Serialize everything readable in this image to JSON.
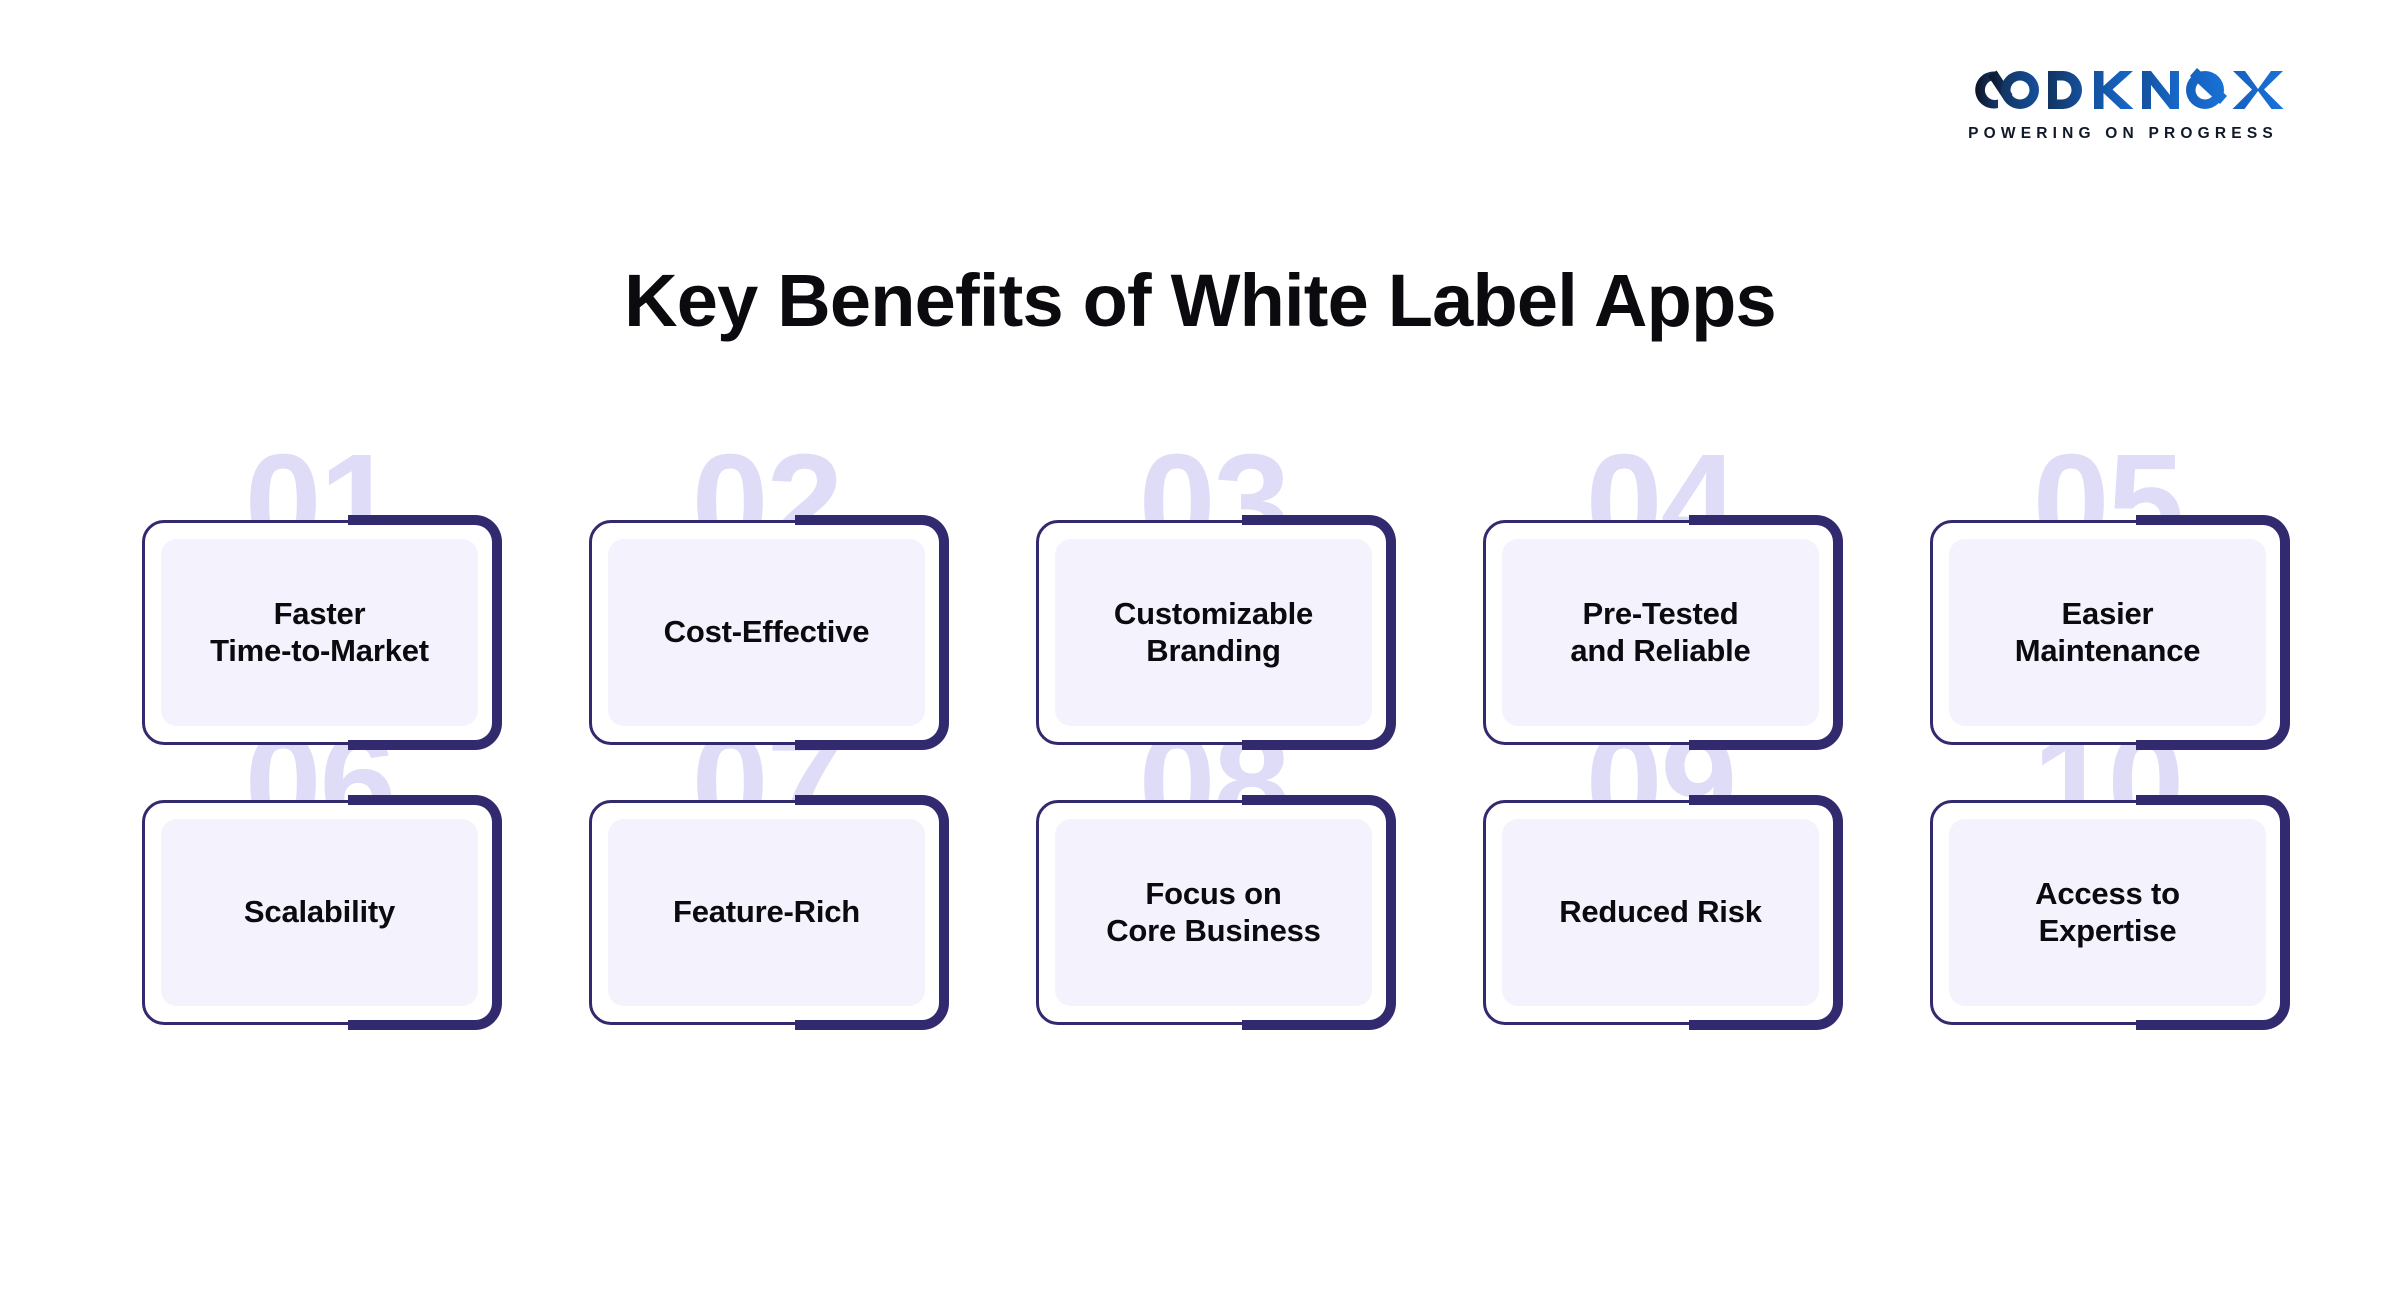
{
  "brand": {
    "logo_text": "CODKNOX",
    "logo_icon": "codknox-wordmark-logo",
    "tagline": "POWERING ON PROGRESS",
    "colors": {
      "logo_dark": "#0d1b33",
      "logo_blue": "#1565c0",
      "accent_navy": "#322a6e",
      "panel_lavender": "#f4f2fd",
      "ghost_number": "#dedcf7",
      "text_dark": "#0b0b0f",
      "background": "#ffffff"
    }
  },
  "header": {
    "title": "Key Benefits of White Label Apps"
  },
  "benefits": [
    {
      "number": "01",
      "label": "Faster\nTime-to-Market"
    },
    {
      "number": "02",
      "label": "Cost-Effective"
    },
    {
      "number": "03",
      "label": "Customizable\nBranding"
    },
    {
      "number": "04",
      "label": "Pre-Tested\nand Reliable"
    },
    {
      "number": "05",
      "label": "Easier\nMaintenance"
    },
    {
      "number": "06",
      "label": "Scalability"
    },
    {
      "number": "07",
      "label": "Feature-Rich"
    },
    {
      "number": "08",
      "label": "Focus on\nCore Business"
    },
    {
      "number": "09",
      "label": "Reduced Risk"
    },
    {
      "number": "10",
      "label": "Access to\nExpertise"
    }
  ]
}
